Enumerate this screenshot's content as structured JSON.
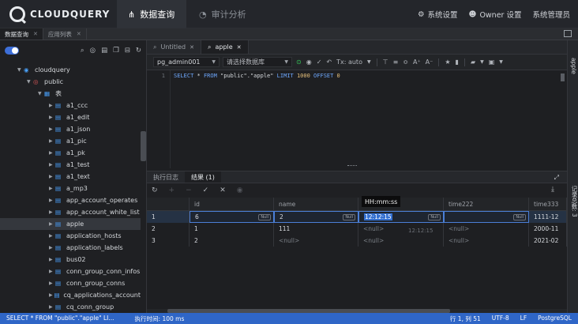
{
  "brand": {
    "logo_text": "CLOUDQUERY"
  },
  "top_nav": [
    {
      "label": "数据查询",
      "icon": "share-nodes-icon"
    },
    {
      "label": "审计分析",
      "icon": "audit-icon"
    }
  ],
  "top_right": [
    {
      "label": "系统设置",
      "icon": "settings-icon"
    },
    {
      "label": "Owner 设置",
      "icon": "user-icon"
    },
    {
      "label": "系统管理员",
      "icon": ""
    }
  ],
  "page_tabs": [
    {
      "label": "数据查询"
    },
    {
      "label": "应用列表"
    }
  ],
  "tree": {
    "connection": "cloudquery",
    "schema": "public",
    "table_group": "表",
    "tables": [
      "a1_ccc",
      "a1_edit",
      "a1_json",
      "a1_pic",
      "a1_pk",
      "a1_test",
      "a1_text",
      "a_mp3",
      "app_account_operates",
      "app_account_white_list",
      "apple",
      "application_hosts",
      "application_labels",
      "bus02",
      "conn_group_conn_infos",
      "conn_group_conns",
      "cq_applications_account",
      "cq_conn_group"
    ],
    "selected": "apple"
  },
  "editor_tabs": [
    {
      "label": "Untitled"
    },
    {
      "label": "apple"
    }
  ],
  "toolbar": {
    "connection": "pg_admin001",
    "database_placeholder": "请选择数据库",
    "tx_mode": "Tx: auto"
  },
  "editor": {
    "line_number": "1",
    "sql_select": "SELECT",
    "sql_star": " * ",
    "sql_from": "FROM",
    "sql_table": " \"public\".\"apple\" ",
    "sql_limit": "LIMIT",
    "sql_limit_val": " 1000 ",
    "sql_offset": "OFFSET",
    "sql_offset_val": " 0"
  },
  "result_tabs": [
    {
      "label": "执行日志"
    },
    {
      "label": "结果 (1)"
    }
  ],
  "right_rail": {
    "label1": "apple",
    "label2": "记录总数: 3"
  },
  "grid": {
    "columns": [
      "",
      "id",
      "name",
      "",
      "time222",
      "time333"
    ],
    "rows": [
      [
        "1",
        "6",
        "2",
        "12:12:15",
        "",
        "1111-12"
      ],
      [
        "2",
        "1",
        "111",
        "<null>",
        "<null>",
        "2000-11"
      ],
      [
        "3",
        "2",
        "<null>",
        "<null>",
        "<null>",
        "2021-02"
      ]
    ],
    "null_badge": "Null",
    "tooltip": "HH:mm:ss",
    "ghost_value": "12:12:15"
  },
  "status": {
    "sql": "SELECT * FROM \"public\".\"apple\" LI...",
    "exec_time": "执行时间: 100 ms",
    "position": "行 1, 列 51",
    "encoding": "UTF-8",
    "eol": "LF",
    "dialect": "PostgreSQL"
  }
}
